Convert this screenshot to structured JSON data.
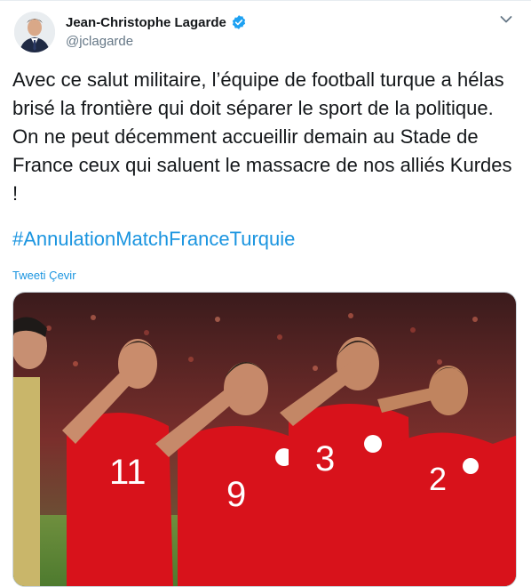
{
  "author": {
    "display_name": "Jean-Christophe Lagarde",
    "handle": "@jclagarde",
    "verified": true
  },
  "tweet": {
    "text": "Avec ce salut militaire, l’équipe de football turque a hélas brisé la frontière qui doit séparer le sport de la politique. On ne peut décemment accueillir demain au Stade de France ceux qui saluent le massacre de nos alliés Kurdes !",
    "hashtag": "#AnnulationMatchFranceTurquie",
    "translate_label": "Tweeti Çevir"
  },
  "media": {
    "description_icon": "photo",
    "jersey_numbers": [
      "11",
      "9",
      "3",
      "2"
    ]
  },
  "colors": {
    "link": "#1b95e0",
    "verified": "#1da1f2",
    "jersey": "#d8121b"
  },
  "icons": [
    "verified-badge-icon",
    "chevron-down-icon"
  ]
}
